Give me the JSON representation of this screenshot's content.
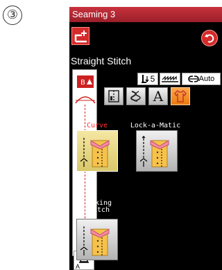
{
  "step_marker": "③",
  "title": "Seaming 3",
  "stitch_name": "Straight Stitch",
  "settings": {
    "foot_pressure": "5",
    "feed_dog": "",
    "thread_tension": "Auto"
  },
  "preview": {
    "badge": "B",
    "presser_foot": "A"
  },
  "options": [
    {
      "label": "Curve",
      "selected": true
    },
    {
      "label": "Lock-a-Matic",
      "selected": false
    },
    {
      "label": "Locking\nStitch",
      "selected": false
    }
  ],
  "colors": {
    "title_bar": "#b3262f",
    "selected_label": "#ff3030",
    "selected_tile": "#eadb8a",
    "active_mode": "#f79a2d"
  },
  "icons": {
    "stitch_adjust": "stitch-adjust-icon",
    "back": "back-arrow-icon",
    "presser_foot": "presser-foot-icon"
  }
}
